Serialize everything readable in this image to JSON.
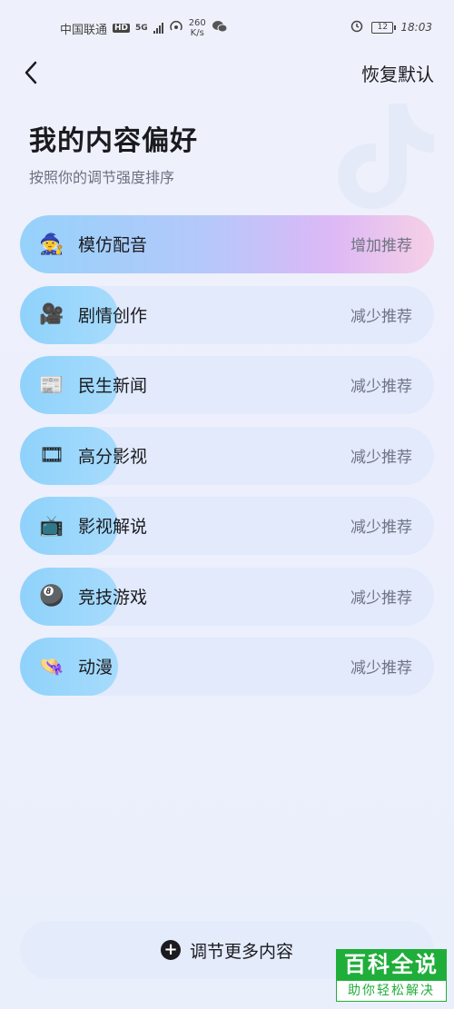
{
  "status_bar": {
    "carrier": "中国联通",
    "hd": "HD",
    "network": "5G",
    "speed_value": "260",
    "speed_unit": "K/s",
    "battery": "12",
    "time": "18:03"
  },
  "header": {
    "back_icon": "chevron-left-icon",
    "reset_label": "恢复默认"
  },
  "title": "我的内容偏好",
  "subtitle": "按照你的调节强度排序",
  "items": [
    {
      "icon": "🧙",
      "icon_name": "wizard-icon",
      "label": "模仿配音",
      "action": "增加推荐",
      "state": "increase"
    },
    {
      "icon": "🎥",
      "icon_name": "movie-camera-icon",
      "label": "剧情创作",
      "action": "减少推荐",
      "state": "decrease"
    },
    {
      "icon": "📰",
      "icon_name": "newspaper-icon",
      "label": "民生新闻",
      "action": "减少推荐",
      "state": "decrease"
    },
    {
      "icon": "🎞",
      "icon_name": "film-strip-icon",
      "label": "高分影视",
      "action": "减少推荐",
      "state": "decrease"
    },
    {
      "icon": "📺",
      "icon_name": "television-icon",
      "label": "影视解说",
      "action": "减少推荐",
      "state": "decrease"
    },
    {
      "icon": "🎱",
      "icon_name": "billiard-ball-icon",
      "label": "竞技游戏",
      "action": "减少推荐",
      "state": "decrease"
    },
    {
      "icon": "👒",
      "icon_name": "straw-hat-icon",
      "label": "动漫",
      "action": "减少推荐",
      "state": "decrease"
    }
  ],
  "more_button": {
    "icon": "plus-circle-icon",
    "label": "调节更多内容"
  },
  "watermark": {
    "top": "百科全说",
    "bottom": "助你轻松解决"
  },
  "colors": {
    "increase_gradient": [
      "#95d2fb",
      "#dcb8f6",
      "#f6d0e5"
    ],
    "decrease_fill": "#8fd2fb",
    "pill_bg": "#e2eafc"
  }
}
